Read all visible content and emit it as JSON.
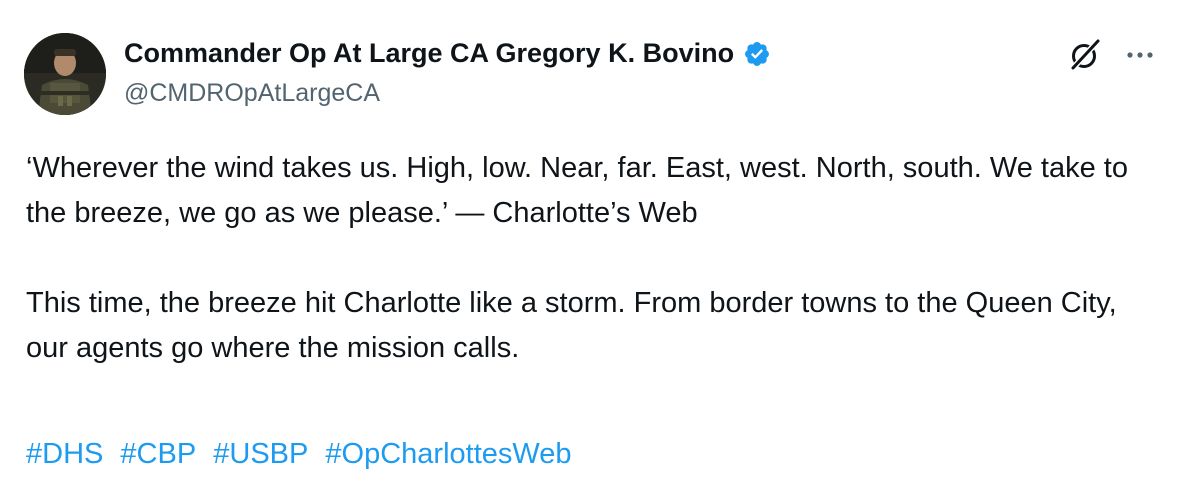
{
  "author": {
    "display_name": "Commander Op At Large CA Gregory K. Bovino",
    "handle": "@CMDROpAtLargeCA",
    "verified_badge_icon": "verified-badge-icon"
  },
  "actions": {
    "grok_icon": "grok-icon",
    "more_icon": "more-options-icon"
  },
  "tweet": {
    "paragraphs": [
      "‘Wherever the wind takes us. High, low. Near, far. East, west. North, south. We take to the breeze, we go as we please.’ — Charlotte’s Web",
      "This time, the breeze hit Charlotte like a storm. From border towns to the Queen City, our agents go where the mission calls."
    ],
    "hashtags": [
      "#DHS",
      "#CBP",
      "#USBP",
      "#OpCharlottesWeb"
    ]
  },
  "colors": {
    "text": "#0f1419",
    "secondary_text": "#536471",
    "link": "#1d9bf0",
    "verified": "#1d9bf0"
  }
}
